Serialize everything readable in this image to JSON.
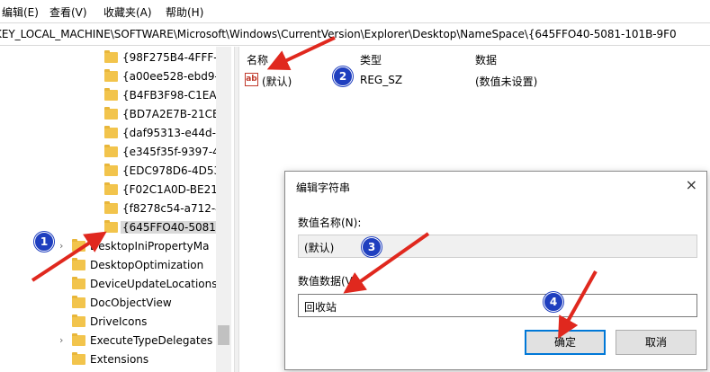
{
  "menu": {
    "favorites_partial": "编辑(E)",
    "view": "查看(V)",
    "favorites": "收藏夹(A)",
    "help": "帮助(H)"
  },
  "address": "KEY_LOCAL_MACHINE\\SOFTWARE\\Microsoft\\Windows\\CurrentVersion\\Explorer\\Desktop\\NameSpace\\{645FFO40-5081-101B-9F0",
  "tree": {
    "items": [
      {
        "label": "{98F275B4-4FFF-1"
      },
      {
        "label": "{a00ee528-ebd9-"
      },
      {
        "label": "{B4FB3F98-C1EA-"
      },
      {
        "label": "{BD7A2E7B-21CB"
      },
      {
        "label": "{daf95313-e44d-"
      },
      {
        "label": "{e345f35f-9397-4"
      },
      {
        "label": "{EDC978D6-4D53"
      },
      {
        "label": "{F02C1A0D-BE21-"
      },
      {
        "label": "{f8278c54-a712-4"
      },
      {
        "label": "{645FFO40-5081-"
      }
    ],
    "siblings": [
      {
        "label": "DesktopIniPropertyMa"
      },
      {
        "label": "DesktopOptimization"
      },
      {
        "label": "DeviceUpdateLocations"
      },
      {
        "label": "DocObjectView"
      },
      {
        "label": "DriveIcons"
      },
      {
        "label": "ExecuteTypeDelegates"
      },
      {
        "label": "Extensions"
      }
    ]
  },
  "list": {
    "headers": {
      "name": "名称",
      "type": "类型",
      "data": "数据"
    },
    "row": {
      "name": "(默认)",
      "type": "REG_SZ",
      "data": "(数值未设置)",
      "icon": "ab-icon"
    }
  },
  "dialog": {
    "title": "编辑字符串",
    "close": "×",
    "name_label": "数值名称(N):",
    "name_value": "(默认)",
    "data_label": "数值数据(V):",
    "data_value": "回收站",
    "ok": "确定",
    "cancel": "取消"
  },
  "badges": [
    "1",
    "2",
    "3",
    "4"
  ],
  "colors": {
    "annotation_red": "#e0281e",
    "badge_blue": "#1f3fbf",
    "folder_yellow": "#f2c44c"
  }
}
